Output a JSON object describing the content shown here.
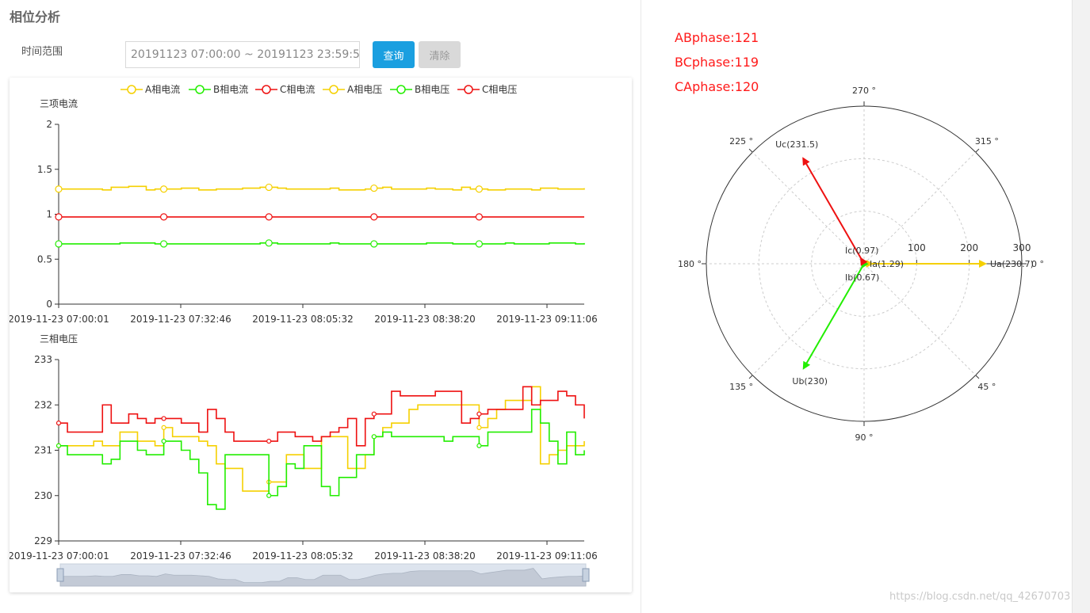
{
  "page": {
    "title": "相位分析",
    "time_label": "时间范围",
    "time_value": "20191123 07:00:00 ~ 20191123 23:59:59",
    "query_label": "查询",
    "clear_label": "清除",
    "watermark": "https://blog.csdn.net/qq_42670703"
  },
  "phases": [
    {
      "label": "ABphase:121"
    },
    {
      "label": "BCphase:119"
    },
    {
      "label": "CAphase:120"
    }
  ],
  "colors": {
    "a": "#f5d000",
    "b": "#22ee00",
    "c": "#ee1111",
    "accent": "#1a9fe0"
  },
  "chart_data": [
    {
      "type": "line",
      "title": "三项电流",
      "ylim": [
        0,
        2
      ],
      "yticks": [
        0,
        0.5,
        1,
        1.5,
        2
      ],
      "x_tick_labels": [
        "2019-11-23 07:00:01",
        "2019-11-23 07:32:46",
        "2019-11-23 08:05:32",
        "2019-11-23 08:38:20",
        "2019-11-23 09:11:06"
      ],
      "legend": [
        "A相电流",
        "B相电流",
        "C相电流",
        "A相电压",
        "B相电压",
        "C相电压"
      ],
      "series": [
        {
          "name": "A相电流",
          "values": [
            1.28,
            1.28,
            1.28,
            1.28,
            1.28,
            1.27,
            1.3,
            1.3,
            1.31,
            1.31,
            1.27,
            1.28,
            1.28,
            1.28,
            1.29,
            1.29,
            1.27,
            1.27,
            1.28,
            1.28,
            1.28,
            1.29,
            1.29,
            1.3,
            1.3,
            1.29,
            1.28,
            1.28,
            1.28,
            1.28,
            1.28,
            1.29,
            1.27,
            1.27,
            1.27,
            1.28,
            1.29,
            1.3,
            1.28,
            1.28,
            1.28,
            1.28,
            1.29,
            1.28,
            1.28,
            1.27,
            1.3,
            1.28,
            1.28,
            1.27,
            1.27,
            1.28,
            1.28,
            1.28,
            1.27,
            1.29,
            1.29,
            1.28,
            1.28,
            1.28,
            1.29
          ]
        },
        {
          "name": "B相电流",
          "values": [
            0.67,
            0.67,
            0.67,
            0.67,
            0.67,
            0.67,
            0.67,
            0.68,
            0.68,
            0.68,
            0.68,
            0.67,
            0.67,
            0.67,
            0.67,
            0.67,
            0.67,
            0.67,
            0.67,
            0.67,
            0.67,
            0.67,
            0.67,
            0.68,
            0.68,
            0.67,
            0.67,
            0.67,
            0.67,
            0.67,
            0.67,
            0.68,
            0.67,
            0.67,
            0.67,
            0.67,
            0.67,
            0.67,
            0.67,
            0.67,
            0.67,
            0.67,
            0.68,
            0.68,
            0.68,
            0.67,
            0.67,
            0.67,
            0.67,
            0.67,
            0.67,
            0.68,
            0.67,
            0.67,
            0.67,
            0.67,
            0.68,
            0.68,
            0.68,
            0.67,
            0.68
          ]
        },
        {
          "name": "C相电流",
          "values": [
            0.97,
            0.97,
            0.97,
            0.97,
            0.97,
            0.97,
            0.97,
            0.97,
            0.97,
            0.97,
            0.97,
            0.97,
            0.97,
            0.97,
            0.97,
            0.97,
            0.97,
            0.97,
            0.97,
            0.97,
            0.97,
            0.97,
            0.97,
            0.97,
            0.97,
            0.97,
            0.97,
            0.97,
            0.97,
            0.97,
            0.97,
            0.97,
            0.97,
            0.97,
            0.97,
            0.97,
            0.97,
            0.97,
            0.97,
            0.97,
            0.97,
            0.97,
            0.97,
            0.97,
            0.97,
            0.97,
            0.97,
            0.97,
            0.97,
            0.97,
            0.97,
            0.97,
            0.97,
            0.97,
            0.97,
            0.97,
            0.97,
            0.97,
            0.97,
            0.97,
            0.97
          ]
        }
      ]
    },
    {
      "type": "line",
      "title": "三相电压",
      "ylim": [
        229,
        233
      ],
      "yticks": [
        229,
        230,
        231,
        232,
        233
      ],
      "x_tick_labels": [
        "2019-11-23 07:00:01",
        "2019-11-23 07:32:46",
        "2019-11-23 08:05:32",
        "2019-11-23 08:38:20",
        "2019-11-23 09:11:06"
      ],
      "series": [
        {
          "name": "A相电压",
          "values": [
            231.1,
            231.1,
            231.1,
            231.1,
            231.2,
            231.1,
            231.1,
            231.4,
            231.4,
            231.2,
            231.2,
            231.1,
            231.5,
            231.3,
            231.3,
            231.3,
            231.2,
            231.1,
            230.7,
            230.6,
            230.6,
            230.1,
            230.1,
            230.1,
            230.3,
            230.3,
            230.9,
            230.9,
            230.6,
            230.6,
            231.3,
            231.3,
            231.3,
            230.6,
            230.6,
            230.9,
            231.3,
            231.5,
            231.6,
            231.6,
            231.9,
            232.0,
            232.0,
            232.0,
            232.0,
            232.0,
            232.0,
            232.0,
            231.5,
            231.7,
            231.9,
            232.1,
            232.1,
            232.1,
            232.4,
            230.7,
            230.9,
            231.0,
            231.1,
            231.1,
            231.2
          ]
        },
        {
          "name": "B相电压",
          "values": [
            231.1,
            230.9,
            230.9,
            230.9,
            230.9,
            230.7,
            230.8,
            231.2,
            231.2,
            231.0,
            230.9,
            230.9,
            231.2,
            231.2,
            231.0,
            230.8,
            230.5,
            229.8,
            229.7,
            230.9,
            230.9,
            230.9,
            230.9,
            230.9,
            230.0,
            230.2,
            230.7,
            230.6,
            231.1,
            231.1,
            230.2,
            230.0,
            230.4,
            230.4,
            230.9,
            230.9,
            231.3,
            231.4,
            231.3,
            231.3,
            231.3,
            231.3,
            231.3,
            231.3,
            231.2,
            231.3,
            231.3,
            231.3,
            231.1,
            231.4,
            231.4,
            231.4,
            231.4,
            231.4,
            231.9,
            231.6,
            231.2,
            230.7,
            231.4,
            230.9,
            231.0
          ]
        },
        {
          "name": "C相电压",
          "values": [
            231.6,
            231.4,
            231.4,
            231.4,
            231.4,
            232.0,
            231.6,
            231.6,
            231.8,
            231.7,
            231.6,
            231.7,
            231.7,
            231.7,
            231.6,
            231.6,
            231.4,
            231.9,
            231.7,
            231.4,
            231.2,
            231.2,
            231.2,
            231.2,
            231.2,
            231.4,
            231.4,
            231.3,
            231.3,
            231.2,
            231.3,
            231.4,
            231.5,
            231.7,
            231.1,
            231.7,
            231.8,
            231.8,
            232.3,
            232.2,
            232.2,
            232.2,
            232.2,
            232.3,
            232.3,
            232.3,
            231.6,
            231.7,
            231.8,
            231.9,
            231.9,
            231.9,
            231.9,
            232.4,
            232.0,
            232.1,
            232.1,
            232.3,
            232.2,
            232.0,
            231.7
          ]
        }
      ]
    },
    {
      "type": "polar",
      "rmax": 300,
      "r_ticks": [
        100,
        200,
        300
      ],
      "angle_labels": [
        "270 °",
        "315 °",
        "0 °",
        "45 °",
        "90 °",
        "135 °",
        "180 °",
        "225 °"
      ],
      "vectors": [
        {
          "label": "Ua(230.7)",
          "angle": 0,
          "value": 230.7,
          "color": "#f5d000"
        },
        {
          "label": "Ub(230)",
          "angle": 120,
          "value": 230,
          "color": "#22ee00"
        },
        {
          "label": "Uc(231.5)",
          "angle": 240,
          "value": 231.5,
          "color": "#ee1111"
        },
        {
          "label": "Ia(1.29)",
          "angle": 0,
          "value": 1.29,
          "color": "#f5d000"
        },
        {
          "label": "Ib(0.67)",
          "angle": 120,
          "value": 0.67,
          "color": "#22ee00"
        },
        {
          "label": "Ic(0.97)",
          "angle": 240,
          "value": 0.97,
          "color": "#ee1111"
        }
      ]
    }
  ]
}
